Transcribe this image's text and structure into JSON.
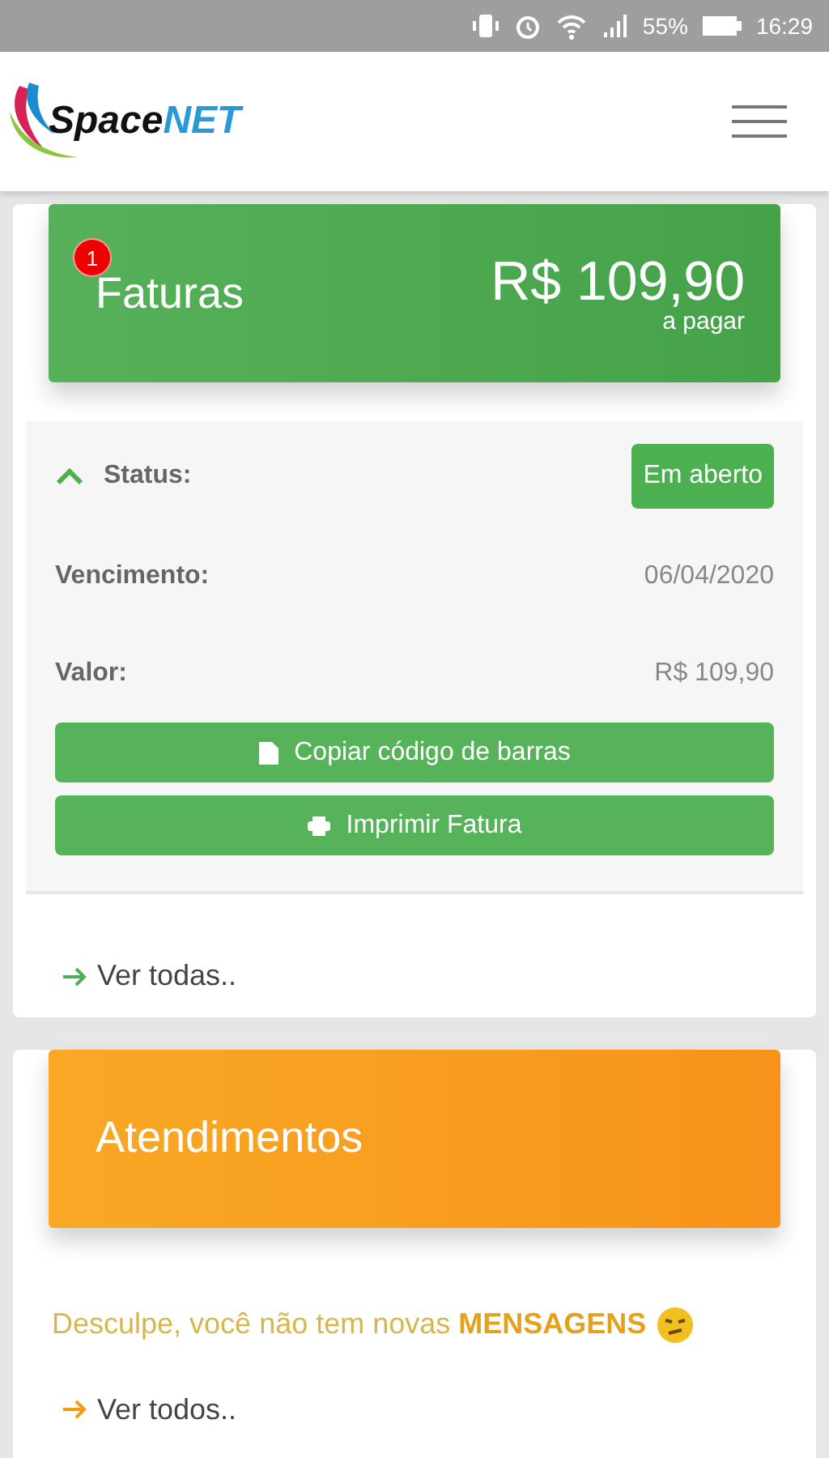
{
  "status_bar": {
    "battery": "55%",
    "time": "16:29"
  },
  "header": {
    "logo": {
      "part_1": "Space",
      "part_2": "NET"
    }
  },
  "invoices": {
    "title": "Faturas",
    "badge": "1",
    "amount": "R$ 109,90",
    "amount_caption": "a pagar",
    "details": {
      "expanded": true,
      "status_label": "Status:",
      "status_value": "Em aberto",
      "due_label": "Vencimento:",
      "due_value": "06/04/2020",
      "value_label": "Valor:",
      "value_value": "R$ 109,90"
    },
    "buttons": [
      {
        "kind": "copy",
        "label": "Copiar código de barras"
      },
      {
        "kind": "print",
        "label": "Imprimir Fatura"
      }
    ],
    "link": "Ver todas.."
  },
  "support": {
    "title": "Atendimentos",
    "message": "Desculpe, você não tem novas **MENSAGENS**",
    "link": "Ver todos.."
  }
}
